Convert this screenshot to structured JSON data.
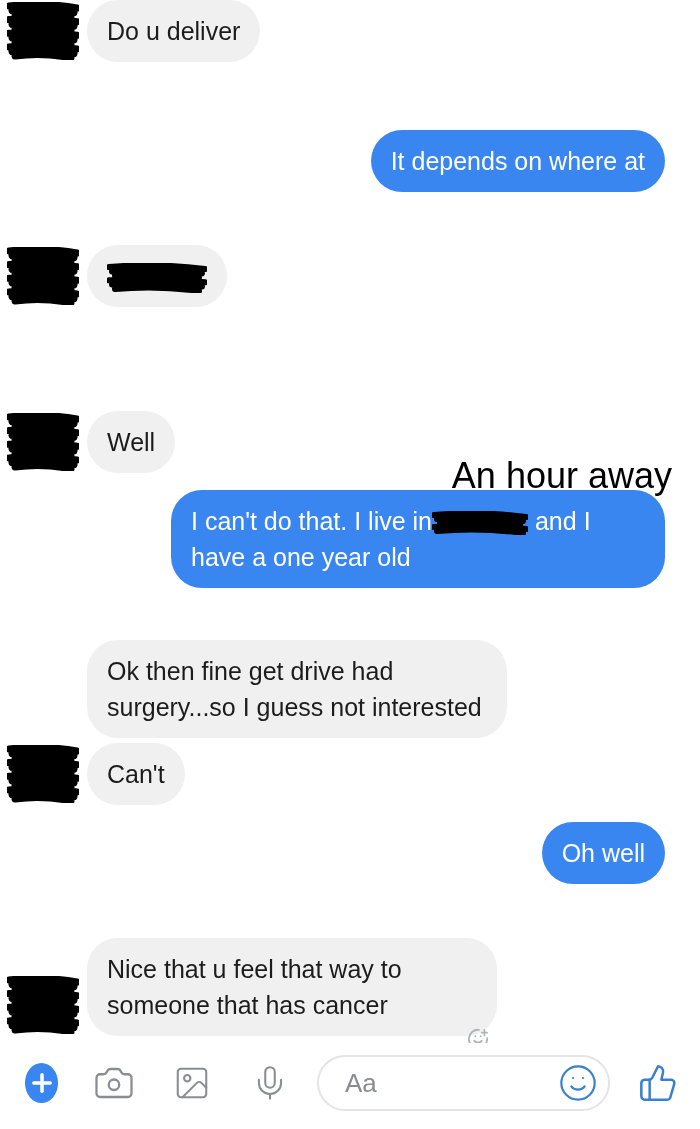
{
  "messages": [
    {
      "kind": "received",
      "avatar": true,
      "segments": [
        {
          "kind": "text",
          "text": "Do u deliver"
        }
      ]
    },
    {
      "kind": "sent",
      "avatar": false,
      "segments": [
        {
          "kind": "text",
          "text": "It depends on where at"
        }
      ]
    },
    {
      "kind": "received",
      "avatar": true,
      "segments": [
        {
          "kind": "redaction"
        }
      ]
    },
    {
      "kind": "received",
      "avatar": true,
      "segments": [
        {
          "kind": "text",
          "text": "Well"
        }
      ]
    },
    {
      "kind": "sent",
      "avatar": false,
      "annotation": "An hour away",
      "segments": [
        {
          "kind": "text",
          "text": "I can't do that. I live in"
        },
        {
          "kind": "redaction"
        },
        {
          "kind": "text",
          "text": "and I have a one year old"
        }
      ]
    },
    {
      "kind": "received",
      "avatar": false,
      "segments": [
        {
          "kind": "text",
          "text": "Ok then fine get drive had surgery...so I guess not interested"
        }
      ]
    },
    {
      "kind": "received",
      "avatar": true,
      "segments": [
        {
          "kind": "text",
          "text": "Can't"
        }
      ]
    },
    {
      "kind": "sent",
      "avatar": false,
      "segments": [
        {
          "kind": "text",
          "text": "Oh well"
        }
      ]
    },
    {
      "kind": "received",
      "avatar": true,
      "reaction_button": true,
      "segments": [
        {
          "kind": "text",
          "text": "Nice that u feel that way to someone that has cancer"
        }
      ]
    }
  ],
  "composer": {
    "placeholder": "Aa"
  }
}
